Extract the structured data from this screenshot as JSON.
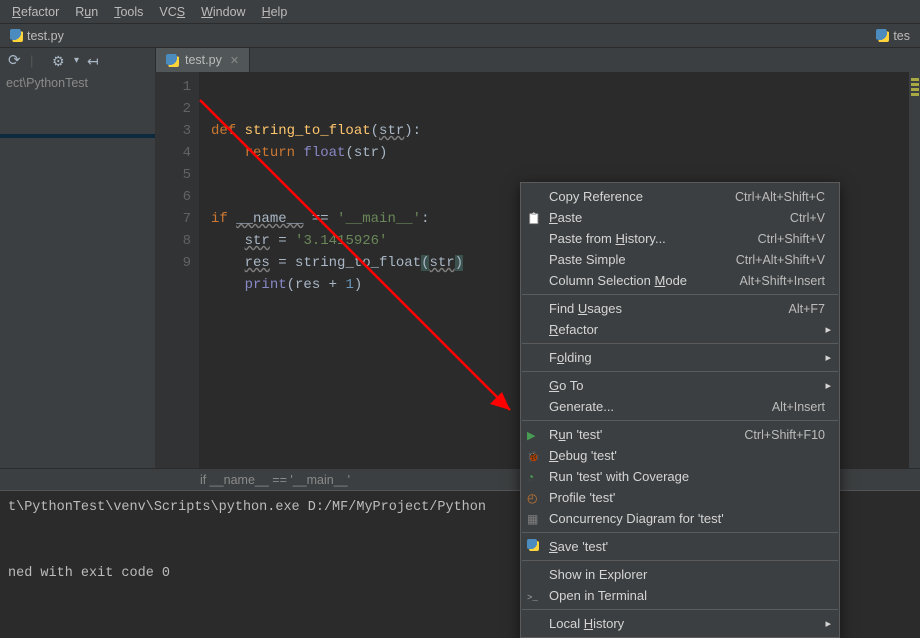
{
  "menubar": {
    "items": [
      {
        "html": "<u>R</u>efactor"
      },
      {
        "html": "R<u>u</u>n"
      },
      {
        "html": "<u>T</u>ools"
      },
      {
        "html": "VC<u>S</u>"
      },
      {
        "html": "<u>W</u>indow"
      },
      {
        "html": "<u>H</u>elp"
      }
    ]
  },
  "top_tab": {
    "file": "test.py"
  },
  "right_top_tab": {
    "file": "tes"
  },
  "editor_tab": {
    "file": "test.py"
  },
  "sidebar": {
    "project_label": "ect\\PythonTest"
  },
  "editor": {
    "lines": [
      "1",
      "2",
      "3",
      "4",
      "5",
      "6",
      "7",
      "8",
      "9"
    ]
  },
  "code": {
    "l1_pre": "def ",
    "l1_fn": "string_to_float",
    "l1_post1": "(",
    "l1_arg": "str",
    "l1_post2": "):",
    "l2_pre": "    ",
    "l2_kw": "return ",
    "l2_bi": "float",
    "l2_post": "(str)",
    "l3": "",
    "l4": "",
    "l5_pre": "if ",
    "l5_name": "__name__",
    "l5_eq": " == ",
    "l5_str": "'__main__'",
    "l5_post": ":",
    "l6_pre": "    ",
    "l6_var": "str",
    "l6_eq": " = ",
    "l6_str": "'3.1415926'",
    "l7_pre": "    ",
    "l7_var": "res",
    "l7_eq": " = ",
    "l7_fn": "string_to_float",
    "l7_op": "(",
    "l7_arg": "str",
    "l7_cl": ")",
    "l8_pre": "    ",
    "l8_bi": "print",
    "l8_op": "(res + ",
    "l8_num": "1",
    "l8_cl": ")"
  },
  "breadcrumb": "if __name__ == '__main__'",
  "console": {
    "line1": "t\\PythonTest\\venv\\Scripts\\python.exe D:/MF/MyProject/Python",
    "line2": "ned with exit code 0"
  },
  "ctx": {
    "copy_ref": {
      "label": "Copy Reference",
      "sc": "Ctrl+Alt+Shift+C"
    },
    "paste": {
      "html": "<u>P</u>aste",
      "sc": "Ctrl+V"
    },
    "paste_hist": {
      "html": "Paste from <u>H</u>istory...",
      "sc": "Ctrl+Shift+V"
    },
    "paste_simple": {
      "label": "Paste Simple",
      "sc": "Ctrl+Alt+Shift+V"
    },
    "col_sel": {
      "html": "Column Selection <u>M</u>ode",
      "sc": "Alt+Shift+Insert"
    },
    "find_usages": {
      "html": "Find <u>U</u>sages",
      "sc": "Alt+F7"
    },
    "refactor": {
      "html": "<u>R</u>efactor"
    },
    "folding": {
      "html": "F<u>o</u>lding"
    },
    "goto": {
      "html": "<u>G</u>o To"
    },
    "generate": {
      "html": "Generate...",
      "sc": "Alt+Insert"
    },
    "run": {
      "html": "R<u>u</u>n 'test'",
      "sc": "Ctrl+Shift+F10"
    },
    "debug": {
      "html": "<u>D</u>ebug 'test'"
    },
    "coverage": {
      "label": "Run 'test' with Coverage"
    },
    "profile": {
      "label": "Profile 'test'"
    },
    "concurrency": {
      "html": "Concurrency Diagram for 'test'"
    },
    "save": {
      "html": "<u>S</u>ave 'test'"
    },
    "show_explorer": {
      "label": "Show in Explorer"
    },
    "open_terminal": {
      "html": "Open in Terminal"
    },
    "local_history": {
      "html": "Local <u>H</u>istory"
    }
  }
}
